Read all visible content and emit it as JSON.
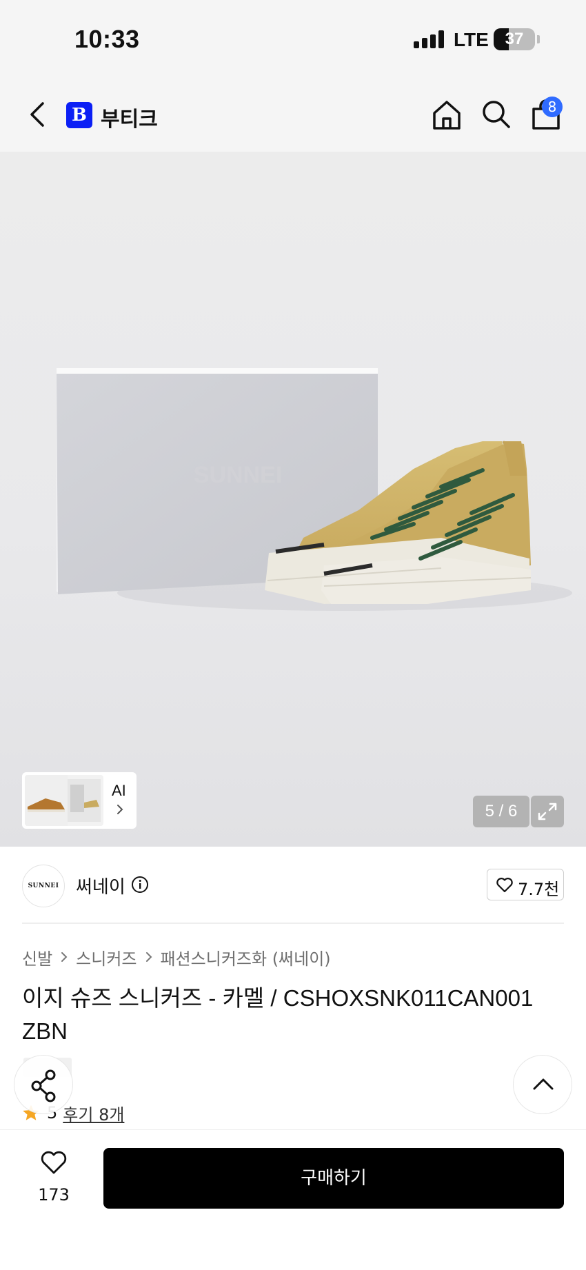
{
  "status_bar": {
    "time": "10:33",
    "network": "LTE",
    "battery": "37",
    "battery_level": 0.37
  },
  "header": {
    "logo_letter": "B",
    "title": "부티크",
    "cart_count": "8"
  },
  "icons": {
    "back": "chevron-left-icon",
    "home": "home-icon",
    "search": "search-icon",
    "cart": "shopping-bag-icon",
    "expand": "expand-icon",
    "info": "info-icon",
    "heart": "heart-icon",
    "share": "share-icon",
    "scroll_top": "chevron-up-icon",
    "star": "star-icon"
  },
  "gallery": {
    "counter": "5 / 6",
    "ai_label": "AI",
    "box_logo": "SUNNEI"
  },
  "brand": {
    "name": "써네이",
    "logo_text": "SUNNEI",
    "likes": "7.7천"
  },
  "breadcrumb": [
    "신발",
    "스니커즈",
    "패션스니커즈화 (써네이)"
  ],
  "product": {
    "title": "이지 슈즈 스니커즈 - 카멜 / CSHOXSNK011CAN001 ZBN"
  },
  "rating": {
    "score": "5",
    "reviews": "후기 8개"
  },
  "bottom": {
    "wish_count": "173",
    "buy_label": "구매하기"
  },
  "colors": {
    "brand_blue": "#0b1ff5",
    "badge_blue": "#2f6bff",
    "star": "#f5a623",
    "buy": "#000000"
  }
}
